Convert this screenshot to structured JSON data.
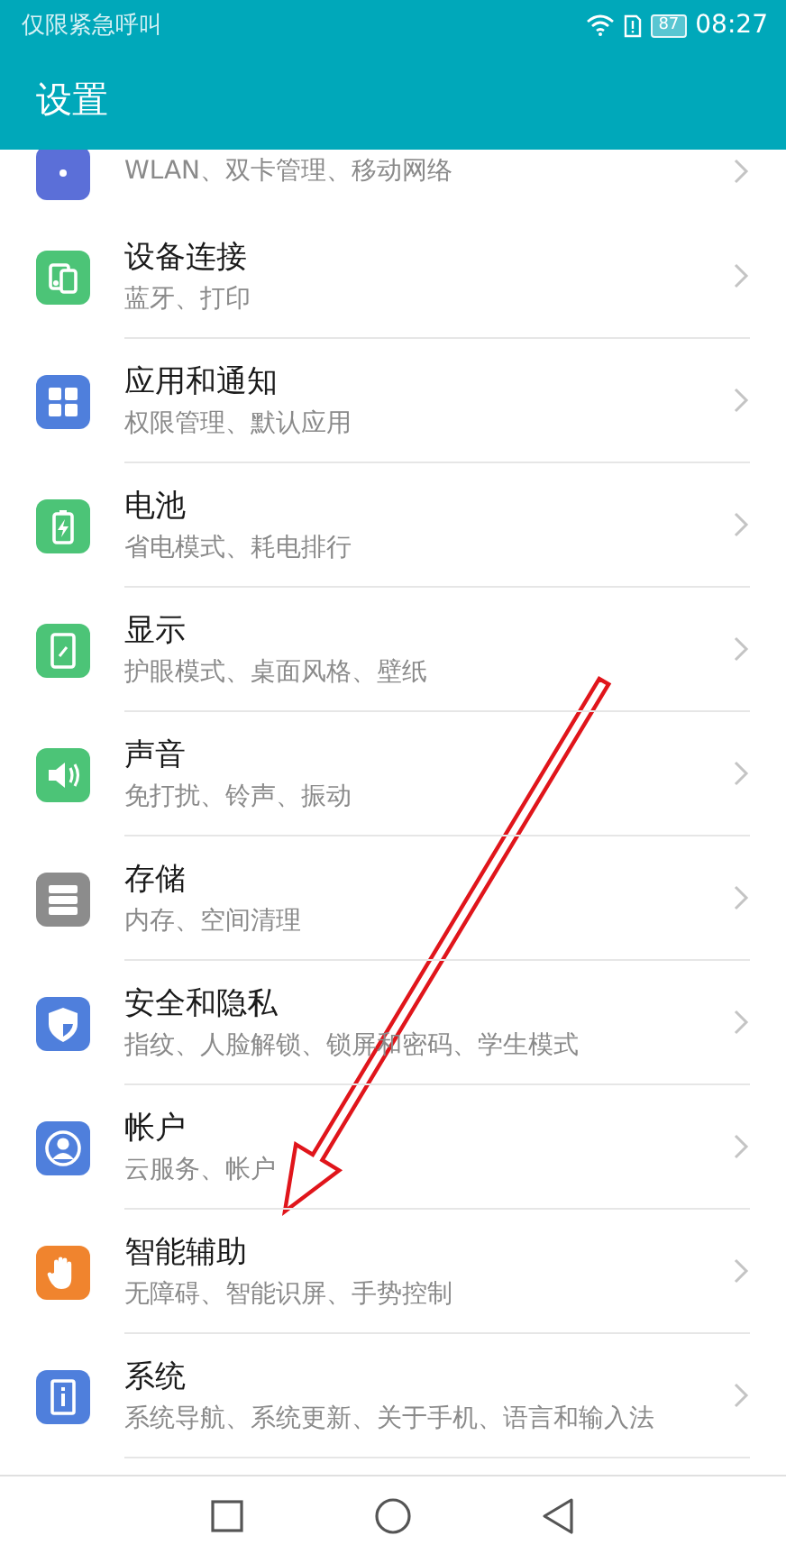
{
  "status_bar": {
    "carrier": "仅限紧急呼叫",
    "battery": "87",
    "time": "08:27"
  },
  "header": {
    "title": "设置"
  },
  "items": [
    {
      "kind": "network",
      "color": "#5b6fd8",
      "subtitle": "WLAN、双卡管理、移动网络"
    },
    {
      "kind": "devices",
      "color": "#4cc477",
      "title": "设备连接",
      "subtitle": "蓝牙、打印"
    },
    {
      "kind": "apps",
      "color": "#4f7fdc",
      "title": "应用和通知",
      "subtitle": "权限管理、默认应用"
    },
    {
      "kind": "battery",
      "color": "#4cc477",
      "title": "电池",
      "subtitle": "省电模式、耗电排行"
    },
    {
      "kind": "display",
      "color": "#4cc477",
      "title": "显示",
      "subtitle": "护眼模式、桌面风格、壁纸"
    },
    {
      "kind": "sound",
      "color": "#4cc477",
      "title": "声音",
      "subtitle": "免打扰、铃声、振动"
    },
    {
      "kind": "storage",
      "color": "#8c8c8c",
      "title": "存储",
      "subtitle": "内存、空间清理"
    },
    {
      "kind": "shield",
      "color": "#4f7fdc",
      "title": "安全和隐私",
      "subtitle": "指纹、人脸解锁、锁屏和密码、学生模式"
    },
    {
      "kind": "person",
      "color": "#4f7fdc",
      "title": "帐户",
      "subtitle": "云服务、帐户"
    },
    {
      "kind": "hand",
      "color": "#f0842e",
      "title": "智能辅助",
      "subtitle": "无障碍、智能识屏、手势控制"
    },
    {
      "kind": "info",
      "color": "#4f7fdc",
      "title": "系统",
      "subtitle": "系统导航、系统更新、关于手机、语言和输入法"
    }
  ]
}
